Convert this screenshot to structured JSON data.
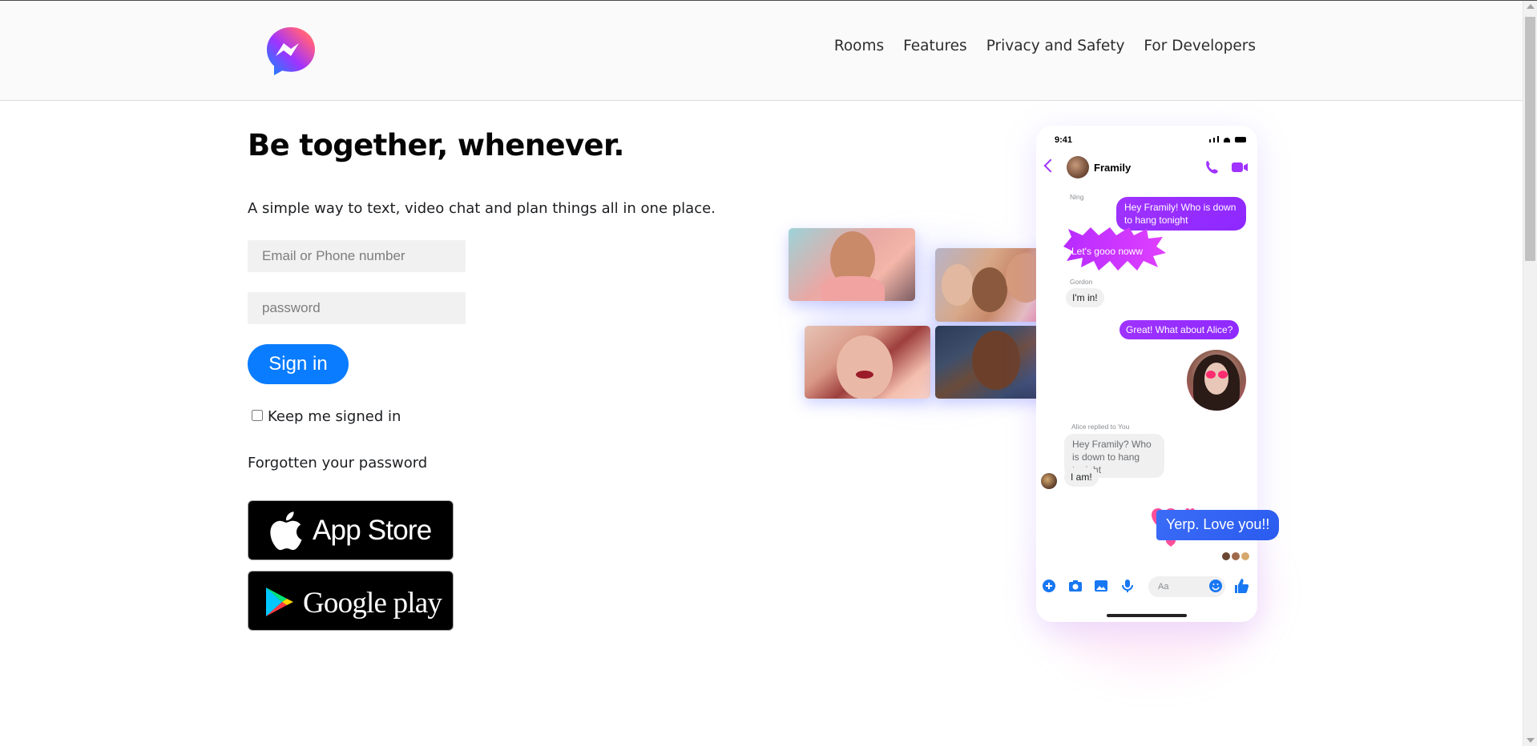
{
  "header": {
    "logo_icon": "messenger-logo-icon",
    "nav": [
      "Rooms",
      "Features",
      "Privacy and Safety",
      "For Developers"
    ]
  },
  "hero": {
    "title": "Be together, whenever.",
    "subtitle": "A simple way to text, video chat and plan things all in one place."
  },
  "form": {
    "email_placeholder": "Email or Phone number",
    "password_placeholder": "password",
    "signin_label": "Sign in",
    "keep_label": "Keep me signed in",
    "keep_checked": false,
    "forgot_label": "Forgotten your password"
  },
  "stores": {
    "app_store_label": "App Store",
    "google_play_label": "Google play"
  },
  "colors": {
    "accent": "#0a7cff",
    "purple": "#a033ff"
  },
  "phone": {
    "time": "9:41",
    "chat_name": "Framily",
    "messages": {
      "m1": "Hey Framily! Who is down to hang tonight",
      "ning_sender": "Ning",
      "ning_msg": "Let's gooo noww",
      "gordon_sender": "Gordon",
      "gordon_msg": "I'm in!",
      "m3": "Great! What about Alice?",
      "reply_note": "Alice replied to You",
      "quoted": "Hey Framily? Who is down to hang tonight",
      "alice_msg": "I am!",
      "love_msg": "Yerp. Love you!!"
    },
    "composer_placeholder": "Aa"
  }
}
